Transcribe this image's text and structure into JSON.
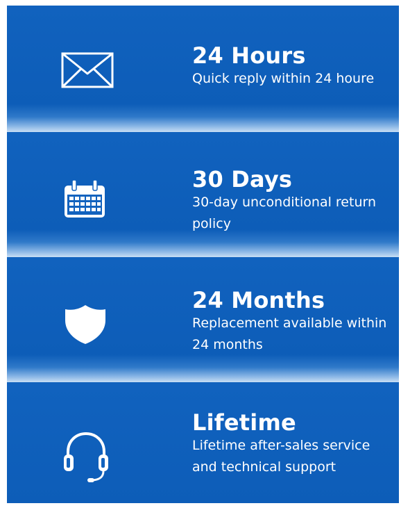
{
  "features": [
    {
      "icon": "envelope-icon",
      "title": "24 Hours",
      "description": "Quick reply within 24 houre"
    },
    {
      "icon": "calendar-icon",
      "title": "30 Days",
      "description": "30-day unconditional return policy"
    },
    {
      "icon": "shield-icon",
      "title": "24 Months",
      "description": "Replacement available within 24 months"
    },
    {
      "icon": "headset-icon",
      "title": "Lifetime",
      "description": "Lifetime after-sales service and technical support"
    }
  ],
  "colors": {
    "panel": "#0e5fbb",
    "text": "#ffffff"
  }
}
